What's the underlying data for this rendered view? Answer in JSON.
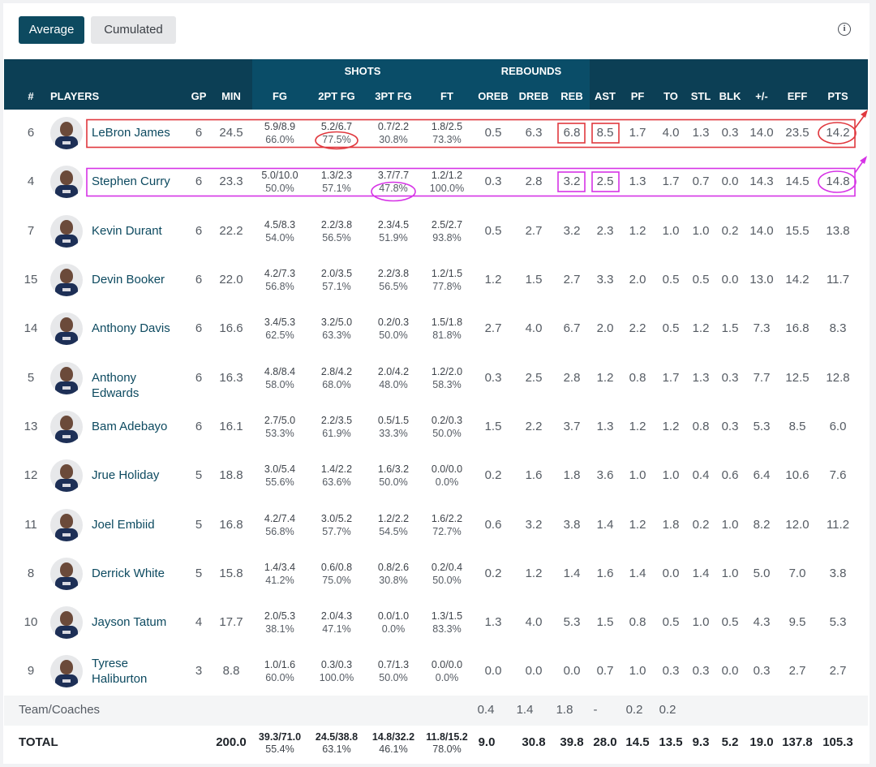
{
  "toggle": {
    "average": "Average",
    "cumulated": "Cumulated"
  },
  "info_icon": "i",
  "groups": {
    "shots": "SHOTS",
    "rebounds": "REBOUNDS"
  },
  "headers": [
    "#",
    "PLAYERS",
    "GP",
    "MIN",
    "FG",
    "2PT FG",
    "3PT FG",
    "FT",
    "OREB",
    "DREB",
    "REB",
    "AST",
    "PF",
    "TO",
    "STL",
    "BLK",
    "+/-",
    "EFF",
    "PTS"
  ],
  "players": [
    {
      "num": "6",
      "name": "LeBron James",
      "gp": "6",
      "min": "24.5",
      "fg": "5.9/8.9",
      "fg_pct": "66.0%",
      "p2": "5.2/6.7",
      "p2_pct": "77.5%",
      "p3": "0.7/2.2",
      "p3_pct": "30.8%",
      "ft": "1.8/2.5",
      "ft_pct": "73.3%",
      "oreb": "0.5",
      "dreb": "6.3",
      "reb": "6.8",
      "ast": "8.5",
      "pf": "1.7",
      "to": "4.0",
      "stl": "1.3",
      "blk": "0.3",
      "pm": "14.0",
      "eff": "23.5",
      "pts": "14.2"
    },
    {
      "num": "4",
      "name": "Stephen Curry",
      "gp": "6",
      "min": "23.3",
      "fg": "5.0/10.0",
      "fg_pct": "50.0%",
      "p2": "1.3/2.3",
      "p2_pct": "57.1%",
      "p3": "3.7/7.7",
      "p3_pct": "47.8%",
      "ft": "1.2/1.2",
      "ft_pct": "100.0%",
      "oreb": "0.3",
      "dreb": "2.8",
      "reb": "3.2",
      "ast": "2.5",
      "pf": "1.3",
      "to": "1.7",
      "stl": "0.7",
      "blk": "0.0",
      "pm": "14.3",
      "eff": "14.5",
      "pts": "14.8"
    },
    {
      "num": "7",
      "name": "Kevin Durant",
      "gp": "6",
      "min": "22.2",
      "fg": "4.5/8.3",
      "fg_pct": "54.0%",
      "p2": "2.2/3.8",
      "p2_pct": "56.5%",
      "p3": "2.3/4.5",
      "p3_pct": "51.9%",
      "ft": "2.5/2.7",
      "ft_pct": "93.8%",
      "oreb": "0.5",
      "dreb": "2.7",
      "reb": "3.2",
      "ast": "2.3",
      "pf": "1.2",
      "to": "1.0",
      "stl": "1.0",
      "blk": "0.2",
      "pm": "14.0",
      "eff": "15.5",
      "pts": "13.8"
    },
    {
      "num": "15",
      "name": "Devin Booker",
      "gp": "6",
      "min": "22.0",
      "fg": "4.2/7.3",
      "fg_pct": "56.8%",
      "p2": "2.0/3.5",
      "p2_pct": "57.1%",
      "p3": "2.2/3.8",
      "p3_pct": "56.5%",
      "ft": "1.2/1.5",
      "ft_pct": "77.8%",
      "oreb": "1.2",
      "dreb": "1.5",
      "reb": "2.7",
      "ast": "3.3",
      "pf": "2.0",
      "to": "0.5",
      "stl": "0.5",
      "blk": "0.0",
      "pm": "13.0",
      "eff": "14.2",
      "pts": "11.7"
    },
    {
      "num": "14",
      "name": "Anthony Davis",
      "gp": "6",
      "min": "16.6",
      "fg": "3.4/5.3",
      "fg_pct": "62.5%",
      "p2": "3.2/5.0",
      "p2_pct": "63.3%",
      "p3": "0.2/0.3",
      "p3_pct": "50.0%",
      "ft": "1.5/1.8",
      "ft_pct": "81.8%",
      "oreb": "2.7",
      "dreb": "4.0",
      "reb": "6.7",
      "ast": "2.0",
      "pf": "2.2",
      "to": "0.5",
      "stl": "1.2",
      "blk": "1.5",
      "pm": "7.3",
      "eff": "16.8",
      "pts": "8.3"
    },
    {
      "num": "5",
      "name": "Anthony Edwards",
      "gp": "6",
      "min": "16.3",
      "fg": "4.8/8.4",
      "fg_pct": "58.0%",
      "p2": "2.8/4.2",
      "p2_pct": "68.0%",
      "p3": "2.0/4.2",
      "p3_pct": "48.0%",
      "ft": "1.2/2.0",
      "ft_pct": "58.3%",
      "oreb": "0.3",
      "dreb": "2.5",
      "reb": "2.8",
      "ast": "1.2",
      "pf": "0.8",
      "to": "1.7",
      "stl": "1.3",
      "blk": "0.3",
      "pm": "7.7",
      "eff": "12.5",
      "pts": "12.8"
    },
    {
      "num": "13",
      "name": "Bam Adebayo",
      "gp": "6",
      "min": "16.1",
      "fg": "2.7/5.0",
      "fg_pct": "53.3%",
      "p2": "2.2/3.5",
      "p2_pct": "61.9%",
      "p3": "0.5/1.5",
      "p3_pct": "33.3%",
      "ft": "0.2/0.3",
      "ft_pct": "50.0%",
      "oreb": "1.5",
      "dreb": "2.2",
      "reb": "3.7",
      "ast": "1.3",
      "pf": "1.2",
      "to": "1.2",
      "stl": "0.8",
      "blk": "0.3",
      "pm": "5.3",
      "eff": "8.5",
      "pts": "6.0"
    },
    {
      "num": "12",
      "name": "Jrue Holiday",
      "gp": "5",
      "min": "18.8",
      "fg": "3.0/5.4",
      "fg_pct": "55.6%",
      "p2": "1.4/2.2",
      "p2_pct": "63.6%",
      "p3": "1.6/3.2",
      "p3_pct": "50.0%",
      "ft": "0.0/0.0",
      "ft_pct": "0.0%",
      "oreb": "0.2",
      "dreb": "1.6",
      "reb": "1.8",
      "ast": "3.6",
      "pf": "1.0",
      "to": "1.0",
      "stl": "0.4",
      "blk": "0.6",
      "pm": "6.4",
      "eff": "10.6",
      "pts": "7.6"
    },
    {
      "num": "11",
      "name": "Joel Embiid",
      "gp": "5",
      "min": "16.8",
      "fg": "4.2/7.4",
      "fg_pct": "56.8%",
      "p2": "3.0/5.2",
      "p2_pct": "57.7%",
      "p3": "1.2/2.2",
      "p3_pct": "54.5%",
      "ft": "1.6/2.2",
      "ft_pct": "72.7%",
      "oreb": "0.6",
      "dreb": "3.2",
      "reb": "3.8",
      "ast": "1.4",
      "pf": "1.2",
      "to": "1.8",
      "stl": "0.2",
      "blk": "1.0",
      "pm": "8.2",
      "eff": "12.0",
      "pts": "11.2"
    },
    {
      "num": "8",
      "name": "Derrick White",
      "gp": "5",
      "min": "15.8",
      "fg": "1.4/3.4",
      "fg_pct": "41.2%",
      "p2": "0.6/0.8",
      "p2_pct": "75.0%",
      "p3": "0.8/2.6",
      "p3_pct": "30.8%",
      "ft": "0.2/0.4",
      "ft_pct": "50.0%",
      "oreb": "0.2",
      "dreb": "1.2",
      "reb": "1.4",
      "ast": "1.6",
      "pf": "1.4",
      "to": "0.0",
      "stl": "1.4",
      "blk": "1.0",
      "pm": "5.0",
      "eff": "7.0",
      "pts": "3.8"
    },
    {
      "num": "10",
      "name": "Jayson Tatum",
      "gp": "4",
      "min": "17.7",
      "fg": "2.0/5.3",
      "fg_pct": "38.1%",
      "p2": "2.0/4.3",
      "p2_pct": "47.1%",
      "p3": "0.0/1.0",
      "p3_pct": "0.0%",
      "ft": "1.3/1.5",
      "ft_pct": "83.3%",
      "oreb": "1.3",
      "dreb": "4.0",
      "reb": "5.3",
      "ast": "1.5",
      "pf": "0.8",
      "to": "0.5",
      "stl": "1.0",
      "blk": "0.5",
      "pm": "4.3",
      "eff": "9.5",
      "pts": "5.3"
    },
    {
      "num": "9",
      "name": "Tyrese Haliburton",
      "gp": "3",
      "min": "8.8",
      "fg": "1.0/1.6",
      "fg_pct": "60.0%",
      "p2": "0.3/0.3",
      "p2_pct": "100.0%",
      "p3": "0.7/1.3",
      "p3_pct": "50.0%",
      "ft": "0.0/0.0",
      "ft_pct": "0.0%",
      "oreb": "0.0",
      "dreb": "0.0",
      "reb": "0.0",
      "ast": "0.7",
      "pf": "1.0",
      "to": "0.3",
      "stl": "0.3",
      "blk": "0.0",
      "pm": "0.3",
      "eff": "2.7",
      "pts": "2.7"
    }
  ],
  "team": {
    "label": "Team/Coaches",
    "oreb": "0.4",
    "dreb": "1.4",
    "reb": "1.8",
    "ast": "-",
    "pf": "0.2",
    "to": "0.2"
  },
  "total": {
    "label": "TOTAL",
    "min": "200.0",
    "fg": "39.3/71.0",
    "fg_pct": "55.4%",
    "p2": "24.5/38.8",
    "p2_pct": "63.1%",
    "p3": "14.8/32.2",
    "p3_pct": "46.1%",
    "ft": "11.8/15.2",
    "ft_pct": "78.0%",
    "oreb": "9.0",
    "dreb": "30.8",
    "reb": "39.8",
    "ast": "28.0",
    "pf": "14.5",
    "to": "13.5",
    "stl": "9.3",
    "blk": "5.2",
    "pm": "19.0",
    "eff": "137.8",
    "pts": "105.3"
  },
  "colors": {
    "header_bg": "#0c3f55",
    "group_bg": "#0a4d68",
    "name": "#0d4a60",
    "red_mark": "#e0383e",
    "magenta_mark": "#d633e6"
  }
}
